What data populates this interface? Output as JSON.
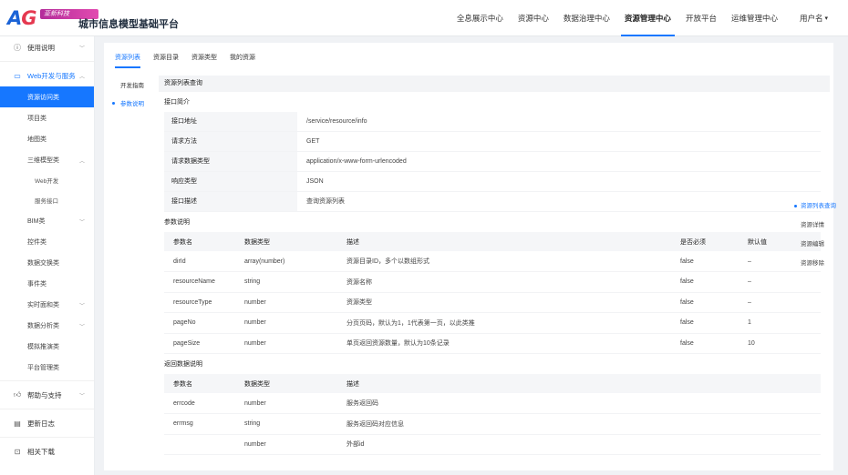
{
  "brand": {
    "logo_text": "AG",
    "logo_ribbon": "亚新科技",
    "title": "城市信息模型基础平台"
  },
  "topnav": {
    "items": [
      {
        "label": "全息展示中心",
        "active": false
      },
      {
        "label": "资源中心",
        "active": false
      },
      {
        "label": "数据治理中心",
        "active": false
      },
      {
        "label": "资源管理中心",
        "active": true
      },
      {
        "label": "开放平台",
        "active": false
      },
      {
        "label": "运维管理中心",
        "active": false
      }
    ],
    "user_label": "用户名"
  },
  "sidebar": {
    "groups": [
      {
        "label": "使用说明",
        "icon": "info-circle-icon"
      },
      {
        "label": "Web开发与服务",
        "icon": "monitor-icon"
      },
      {
        "label": "帮助与支持",
        "icon": "thumbs-up-icon"
      },
      {
        "label": "更新日志",
        "icon": "document-icon"
      },
      {
        "label": "相关下载",
        "icon": "download-icon"
      }
    ],
    "items": [
      {
        "label": "资源访问类"
      },
      {
        "label": "项目类"
      },
      {
        "label": "地图类"
      },
      {
        "label": "三维模型类"
      },
      {
        "label": "Web开发"
      },
      {
        "label": "服务接口"
      },
      {
        "label": "BIM类"
      },
      {
        "label": "控件类"
      },
      {
        "label": "数据交换类"
      },
      {
        "label": "事件类"
      },
      {
        "label": "实时面和类"
      },
      {
        "label": "数据分析类"
      },
      {
        "label": "模拟推演类"
      },
      {
        "label": "平台管理类"
      }
    ]
  },
  "tabs": [
    "资源列表",
    "资源目录",
    "资源类型",
    "我的资源"
  ],
  "doc_nav": [
    "开发指南",
    "参数说明"
  ],
  "content": {
    "header": "资源列表查询",
    "intro_title": "接口简介",
    "intro": [
      {
        "k": "接口地址",
        "v": "/service/resource/info"
      },
      {
        "k": "请求方法",
        "v": "GET"
      },
      {
        "k": "请求数据类型",
        "v": "application/x-www-form-urlencoded"
      },
      {
        "k": "响应类型",
        "v": "JSON"
      },
      {
        "k": "接口描述",
        "v": "查询资源列表"
      }
    ],
    "params_title": "参数说明",
    "params_headers": [
      "参数名",
      "数据类型",
      "描述",
      "是否必须",
      "默认值"
    ],
    "params_rows": [
      [
        "dirId",
        "array(number)",
        "资源目录ID，多个以数组形式",
        "false",
        "–"
      ],
      [
        "resourceName",
        "string",
        "资源名称",
        "false",
        "–"
      ],
      [
        "resourceType",
        "number",
        "资源类型",
        "false",
        "–"
      ],
      [
        "pageNo",
        "number",
        "分页页码，默认为1，1代表第一页，以此类推",
        "false",
        "1"
      ],
      [
        "pageSize",
        "number",
        "单页返回资源数量，默认为10条记录",
        "false",
        "10"
      ]
    ],
    "return_title": "返回数据说明",
    "return_headers": [
      "参数名",
      "数据类型",
      "描述"
    ],
    "return_rows": [
      [
        "errcode",
        "number",
        "服务返回码"
      ],
      [
        "errmsg",
        "string",
        "服务返回码对应信息"
      ],
      [
        "",
        "number",
        "外部id"
      ]
    ]
  },
  "anchor": [
    "资源列表查询",
    "资源详情",
    "资源编辑",
    "资源移除"
  ]
}
